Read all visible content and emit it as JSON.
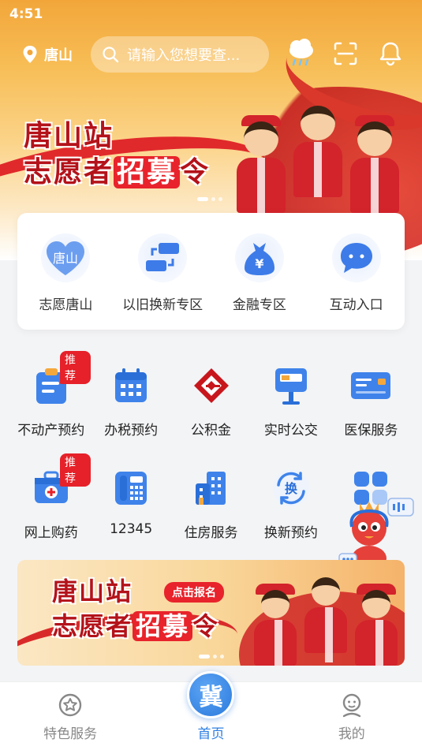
{
  "status": {
    "time": "4:51"
  },
  "header": {
    "location": "唐山",
    "search_placeholder": "请输入您想要查..."
  },
  "hero_banner": {
    "line1": "唐山站",
    "line2_prefix": "志愿者",
    "line2_highlight": "招募",
    "line2_suffix": "令"
  },
  "quick_entries": [
    {
      "label": "志愿唐山",
      "icon_text": "唐山"
    },
    {
      "label": "以旧换新专区"
    },
    {
      "label": "金融专区",
      "icon_text": "¥"
    },
    {
      "label": "互动入口"
    }
  ],
  "services_row1": [
    {
      "label": "不动产预约",
      "badge": "推荐"
    },
    {
      "label": "办税预约"
    },
    {
      "label": "公积金"
    },
    {
      "label": "实时公交"
    },
    {
      "label": "医保服务"
    }
  ],
  "services_row2": [
    {
      "label": "网上购药",
      "badge": "推荐"
    },
    {
      "label": "12345"
    },
    {
      "label": "住房服务"
    },
    {
      "label": "换新预约",
      "icon_text": "换"
    },
    {
      "label": ""
    }
  ],
  "banner2": {
    "line1": "唐山站",
    "line2_prefix": "志愿者",
    "line2_highlight": "招募",
    "line2_suffix": "令",
    "button": "点击报名"
  },
  "tabbar": {
    "tabs": [
      {
        "label": "特色服务"
      },
      {
        "label": "首页",
        "icon_text": "冀"
      },
      {
        "label": "我的"
      }
    ]
  },
  "colors": {
    "accent": "#2d7fe3",
    "badge": "#e62129",
    "hero": "#f2a63a"
  }
}
